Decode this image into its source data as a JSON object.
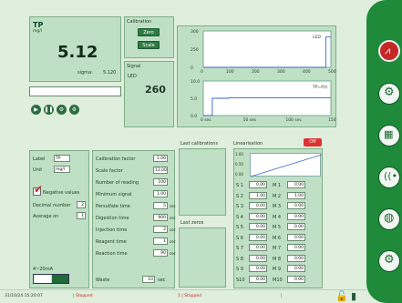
{
  "main": {
    "title": "TP",
    "unit": "mg/l",
    "value": "5.12",
    "sigma_label": "sigma:",
    "sigma_value": "5.120"
  },
  "calibration": {
    "title": "Calibration",
    "zero": "Zero",
    "scale": "Scale"
  },
  "signal": {
    "title": "Signal",
    "led": "LED",
    "value": "260"
  },
  "chart_top": {
    "legend": "LED",
    "y_ticks": [
      "300",
      "250",
      "0"
    ],
    "x_ticks": [
      "0",
      "100",
      "200",
      "300",
      "400",
      "500"
    ],
    "y_range": [
      0,
      300
    ],
    "x_range": [
      0,
      500
    ],
    "series": [
      {
        "x": [
          0,
          480,
          480,
          500
        ],
        "y": [
          0,
          0,
          250,
          250
        ]
      }
    ]
  },
  "chart_bottom": {
    "legend": "TP=f(t)",
    "y_ticks": [
      "10.0",
      "5.0",
      "0.0"
    ],
    "x_ticks": [
      "0 sec",
      "50 sec",
      "100 sec",
      "150 sec"
    ],
    "y_range": [
      0,
      10
    ],
    "x_range": [
      0,
      170
    ],
    "series": [
      {
        "x": [
          0,
          12,
          12,
          34,
          34,
          170
        ],
        "y": [
          0,
          0,
          5,
          5,
          5.1,
          5.1
        ]
      }
    ]
  },
  "params_left": {
    "label_label": "Label",
    "label_value": "TP",
    "unit_label": "Unit",
    "unit_value": "mg/l",
    "negative_label": "Negative values",
    "decimal_label": "Decimal number",
    "decimal_value": "2",
    "average_label": "Average on",
    "average_value": "1",
    "analog_label": "4~20mA"
  },
  "params_mid": {
    "rows": [
      {
        "label": "Calibration factor",
        "value": "1.00"
      },
      {
        "label": "Scale factor",
        "value": "13.00"
      },
      {
        "label": "Number of reading",
        "value": "100"
      },
      {
        "label": "Minimum signal",
        "value": "1.00"
      },
      {
        "label": "Persulfate time",
        "value": "5",
        "unit": "sec"
      },
      {
        "label": "Digestion time",
        "value": "900",
        "unit": "sec"
      },
      {
        "label": "Injection time",
        "value": "2",
        "unit": "sec"
      },
      {
        "label": "Reagent time",
        "value": "1",
        "unit": "sec"
      },
      {
        "label": "Reaction time",
        "value": "90",
        "unit": "sec"
      }
    ],
    "waste_label": "Waste",
    "waste_value": "10",
    "waste_unit": "sec"
  },
  "last_calibrations": {
    "title": "Last calibrations"
  },
  "last_zeros": {
    "title": "Last zeros"
  },
  "linearisation": {
    "title": "Linearisation",
    "badge": "Off",
    "chart_ticks": [
      "1.00",
      "0.50",
      "0.00"
    ],
    "rows": [
      {
        "s": "S 1",
        "sv": "0.00",
        "m": "M 1",
        "mv": "0.00"
      },
      {
        "s": "S 2",
        "sv": "1.00",
        "m": "M 2",
        "mv": "1.00"
      },
      {
        "s": "S 3",
        "sv": "0.00",
        "m": "M 3",
        "mv": "0.00"
      },
      {
        "s": "S 4",
        "sv": "0.00",
        "m": "M 4",
        "mv": "0.00"
      },
      {
        "s": "S 5",
        "sv": "0.00",
        "m": "M 5",
        "mv": "0.00"
      },
      {
        "s": "S 6",
        "sv": "0.00",
        "m": "M 6",
        "mv": "0.00"
      },
      {
        "s": "S 7",
        "sv": "0.00",
        "m": "M 7",
        "mv": "0.00"
      },
      {
        "s": "S 8",
        "sv": "0.00",
        "m": "M 8",
        "mv": "0.00"
      },
      {
        "s": "S 9",
        "sv": "0.00",
        "m": "M 9",
        "mv": "0.00"
      },
      {
        "s": "S10",
        "sv": "0.00",
        "m": "M10",
        "mv": "0.00"
      }
    ]
  },
  "status": {
    "datetime": "31/10/24 15:20:07",
    "state1": "| Stopped",
    "state2": "1 | Stopped",
    "pipe": "|"
  },
  "colors": {
    "panel": "#bfe0c4",
    "accent": "#1f8a3a",
    "stop": "#c62828"
  }
}
